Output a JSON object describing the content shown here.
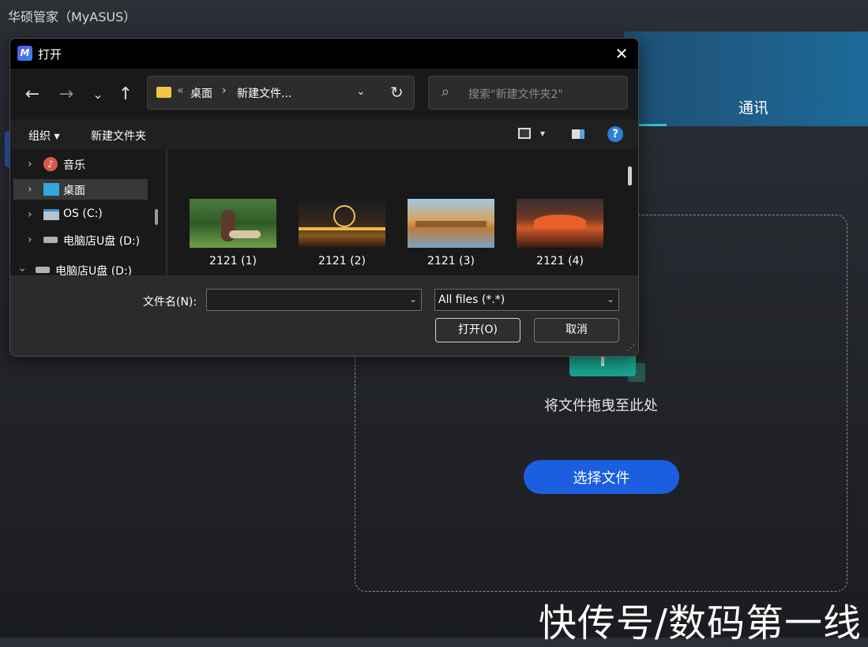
{
  "app": {
    "title": "华硕管家（MyASUS）",
    "tab_comm": "通讯"
  },
  "dropzone": {
    "text": "将文件拖曳至此处",
    "select_button": "选择文件"
  },
  "watermark": "快传号/数码第一线",
  "dialog": {
    "title": "打开",
    "close": "✕",
    "address": {
      "overflow": "«",
      "seg1": "桌面",
      "sep": "›",
      "seg2": "新建文件..."
    },
    "search_placeholder": "搜索\"新建文件夹2\"",
    "toolbar": {
      "organize": "组织 ▾",
      "new_folder": "新建文件夹",
      "help": "?"
    },
    "nav_items": [
      {
        "label": "音乐",
        "icon": "music-icon"
      },
      {
        "label": "桌面",
        "icon": "desktop-icon"
      },
      {
        "label": "OS (C:)",
        "icon": "os-drive-icon"
      },
      {
        "label": "电脑店U盘 (D:)",
        "icon": "usb-drive-icon"
      },
      {
        "label": "电脑店U盘 (D:)",
        "icon": "usb-drive-icon"
      }
    ],
    "files": [
      {
        "name": "2121 (1)"
      },
      {
        "name": "2121 (2)"
      },
      {
        "name": "2121 (3)"
      },
      {
        "name": "2121 (4)"
      }
    ],
    "filename_label": "文件名(N):",
    "filename_value": "",
    "filter": "All files (*.*)",
    "open_button": "打开(O)",
    "cancel_button": "取消"
  },
  "colors": {
    "accent_blue": "#1b5fe0",
    "teal": "#1aa792"
  }
}
